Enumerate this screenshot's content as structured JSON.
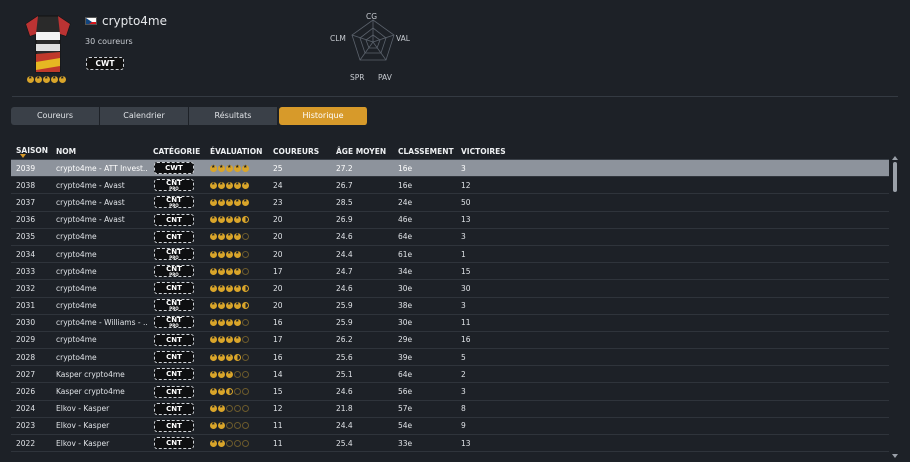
{
  "team": {
    "name": "crypto4me",
    "rider_count": "30 coureurs",
    "category": "CWT",
    "rating_stars": 5
  },
  "radar": {
    "labels": [
      "CG",
      "VAL",
      "PAV",
      "SPR",
      "CLM"
    ]
  },
  "tabs": [
    {
      "label": "Coureurs",
      "active": false
    },
    {
      "label": "Calendrier",
      "active": false
    },
    {
      "label": "Résultats",
      "active": false
    },
    {
      "label": "Historique",
      "active": true
    }
  ],
  "table": {
    "columns": [
      "SAISON",
      "NOM",
      "CATÉGORIE",
      "ÉVALUATION",
      "COUREURS",
      "ÂGE MOYEN",
      "CLASSEMENT",
      "VICTOIRES"
    ],
    "rows": [
      {
        "saison": "2039",
        "nom": "crypto4me - ATT Invest..",
        "cat": "CWT",
        "pro": false,
        "stars": 5,
        "coureurs": "25",
        "age": "27.2",
        "classement": "16e",
        "victoires": "3",
        "selected": true
      },
      {
        "saison": "2038",
        "nom": "crypto4me - Avast",
        "cat": "CNT",
        "pro": true,
        "stars": 5,
        "coureurs": "24",
        "age": "26.7",
        "classement": "16e",
        "victoires": "12"
      },
      {
        "saison": "2037",
        "nom": "crypto4me - Avast",
        "cat": "CNT",
        "pro": true,
        "stars": 5,
        "coureurs": "23",
        "age": "28.5",
        "classement": "24e",
        "victoires": "50"
      },
      {
        "saison": "2036",
        "nom": "crypto4me - Avast",
        "cat": "CNT",
        "pro": false,
        "stars": 4.5,
        "coureurs": "20",
        "age": "26.9",
        "classement": "46e",
        "victoires": "13"
      },
      {
        "saison": "2035",
        "nom": "crypto4me",
        "cat": "CNT",
        "pro": false,
        "stars": 4,
        "coureurs": "20",
        "age": "24.6",
        "classement": "64e",
        "victoires": "3"
      },
      {
        "saison": "2034",
        "nom": "crypto4me",
        "cat": "CNT",
        "pro": true,
        "stars": 4,
        "coureurs": "20",
        "age": "24.4",
        "classement": "61e",
        "victoires": "1"
      },
      {
        "saison": "2033",
        "nom": "crypto4me",
        "cat": "CNT",
        "pro": true,
        "stars": 4,
        "coureurs": "17",
        "age": "24.7",
        "classement": "34e",
        "victoires": "15"
      },
      {
        "saison": "2032",
        "nom": "crypto4me",
        "cat": "CNT",
        "pro": false,
        "stars": 4.5,
        "coureurs": "20",
        "age": "24.6",
        "classement": "30e",
        "victoires": "30"
      },
      {
        "saison": "2031",
        "nom": "crypto4me",
        "cat": "CNT",
        "pro": true,
        "stars": 4.5,
        "coureurs": "20",
        "age": "25.9",
        "classement": "38e",
        "victoires": "3"
      },
      {
        "saison": "2030",
        "nom": "crypto4me - Williams - ..",
        "cat": "CNT",
        "pro": true,
        "stars": 4,
        "coureurs": "16",
        "age": "25.9",
        "classement": "30e",
        "victoires": "11"
      },
      {
        "saison": "2029",
        "nom": "crypto4me",
        "cat": "CNT",
        "pro": false,
        "stars": 4,
        "coureurs": "17",
        "age": "26.2",
        "classement": "29e",
        "victoires": "16"
      },
      {
        "saison": "2028",
        "nom": "crypto4me",
        "cat": "CNT",
        "pro": false,
        "stars": 3.5,
        "coureurs": "16",
        "age": "25.6",
        "classement": "39e",
        "victoires": "5"
      },
      {
        "saison": "2027",
        "nom": "Kasper crypto4me",
        "cat": "CNT",
        "pro": false,
        "stars": 3,
        "coureurs": "14",
        "age": "25.1",
        "classement": "64e",
        "victoires": "2"
      },
      {
        "saison": "2026",
        "nom": "Kasper crypto4me",
        "cat": "CNT",
        "pro": false,
        "stars": 2.5,
        "coureurs": "15",
        "age": "24.6",
        "classement": "56e",
        "victoires": "3"
      },
      {
        "saison": "2024",
        "nom": "Elkov - Kasper",
        "cat": "CNT",
        "pro": false,
        "stars": 2,
        "coureurs": "12",
        "age": "21.8",
        "classement": "57e",
        "victoires": "8"
      },
      {
        "saison": "2023",
        "nom": "Elkov - Kasper",
        "cat": "CNT",
        "pro": false,
        "stars": 2,
        "coureurs": "11",
        "age": "24.4",
        "classement": "54e",
        "victoires": "9"
      },
      {
        "saison": "2022",
        "nom": "Elkov - Kasper",
        "cat": "CNT",
        "pro": false,
        "stars": 2,
        "coureurs": "11",
        "age": "25.4",
        "classement": "33e",
        "victoires": "13"
      }
    ]
  },
  "colors": {
    "accent": "#d79a2a",
    "background": "#1d2127",
    "selected_row": "#8d939c"
  }
}
